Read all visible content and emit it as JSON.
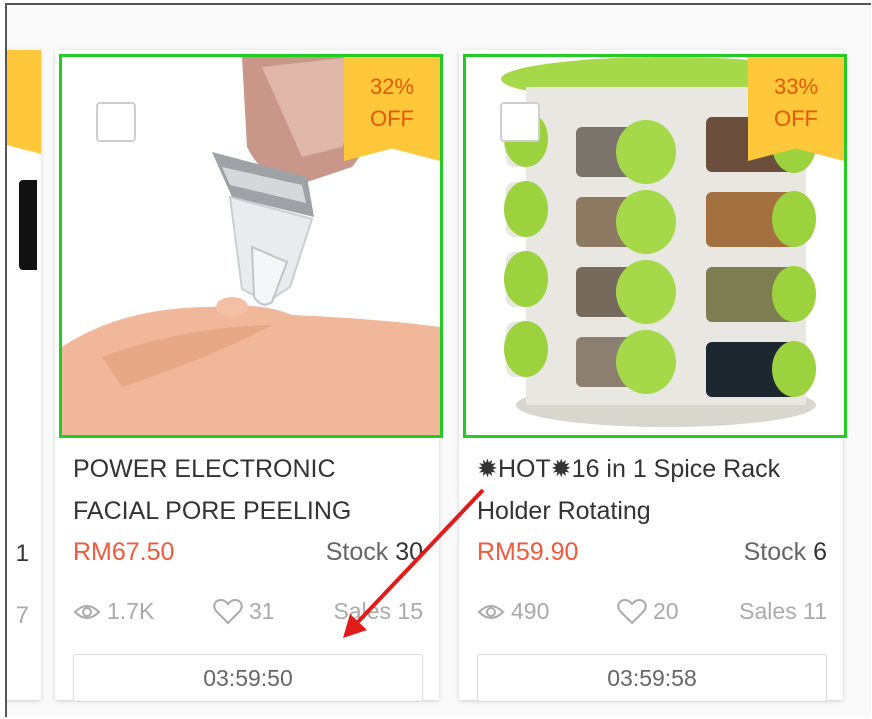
{
  "partial_card": {
    "stock_digit": "1",
    "sales_digit": "7",
    "badge_fragment": "%"
  },
  "products": [
    {
      "badge_pct": "32%",
      "badge_off": "OFF",
      "title_line1": "POWER ELECTRONIC",
      "title_line2": "FACIAL PORE PEELING",
      "price": "RM67.50",
      "stock_label": "Stock",
      "stock_value": "30",
      "views": "1.7K",
      "likes": "31",
      "sales_label": "Sales",
      "sales_value": "15",
      "timer": "03:59:50",
      "image_icon": "facial-pore-device-photo"
    },
    {
      "badge_pct": "33%",
      "badge_off": "OFF",
      "title_line1": "✹HOT✹16 in 1 Spice Rack",
      "title_line2": "Holder Rotating",
      "price": "RM59.90",
      "stock_label": "Stock",
      "stock_value": "6",
      "views": "490",
      "likes": "20",
      "sales_label": "Sales",
      "sales_value": "11",
      "timer": "03:59:58",
      "image_icon": "spice-rack-photo"
    }
  ],
  "colors": {
    "accent_border": "#22cc22",
    "badge_bg": "#ffc83a",
    "badge_text": "#e35a00",
    "price": "#ee5a3b",
    "annotation_arrow": "#e11a1a"
  }
}
